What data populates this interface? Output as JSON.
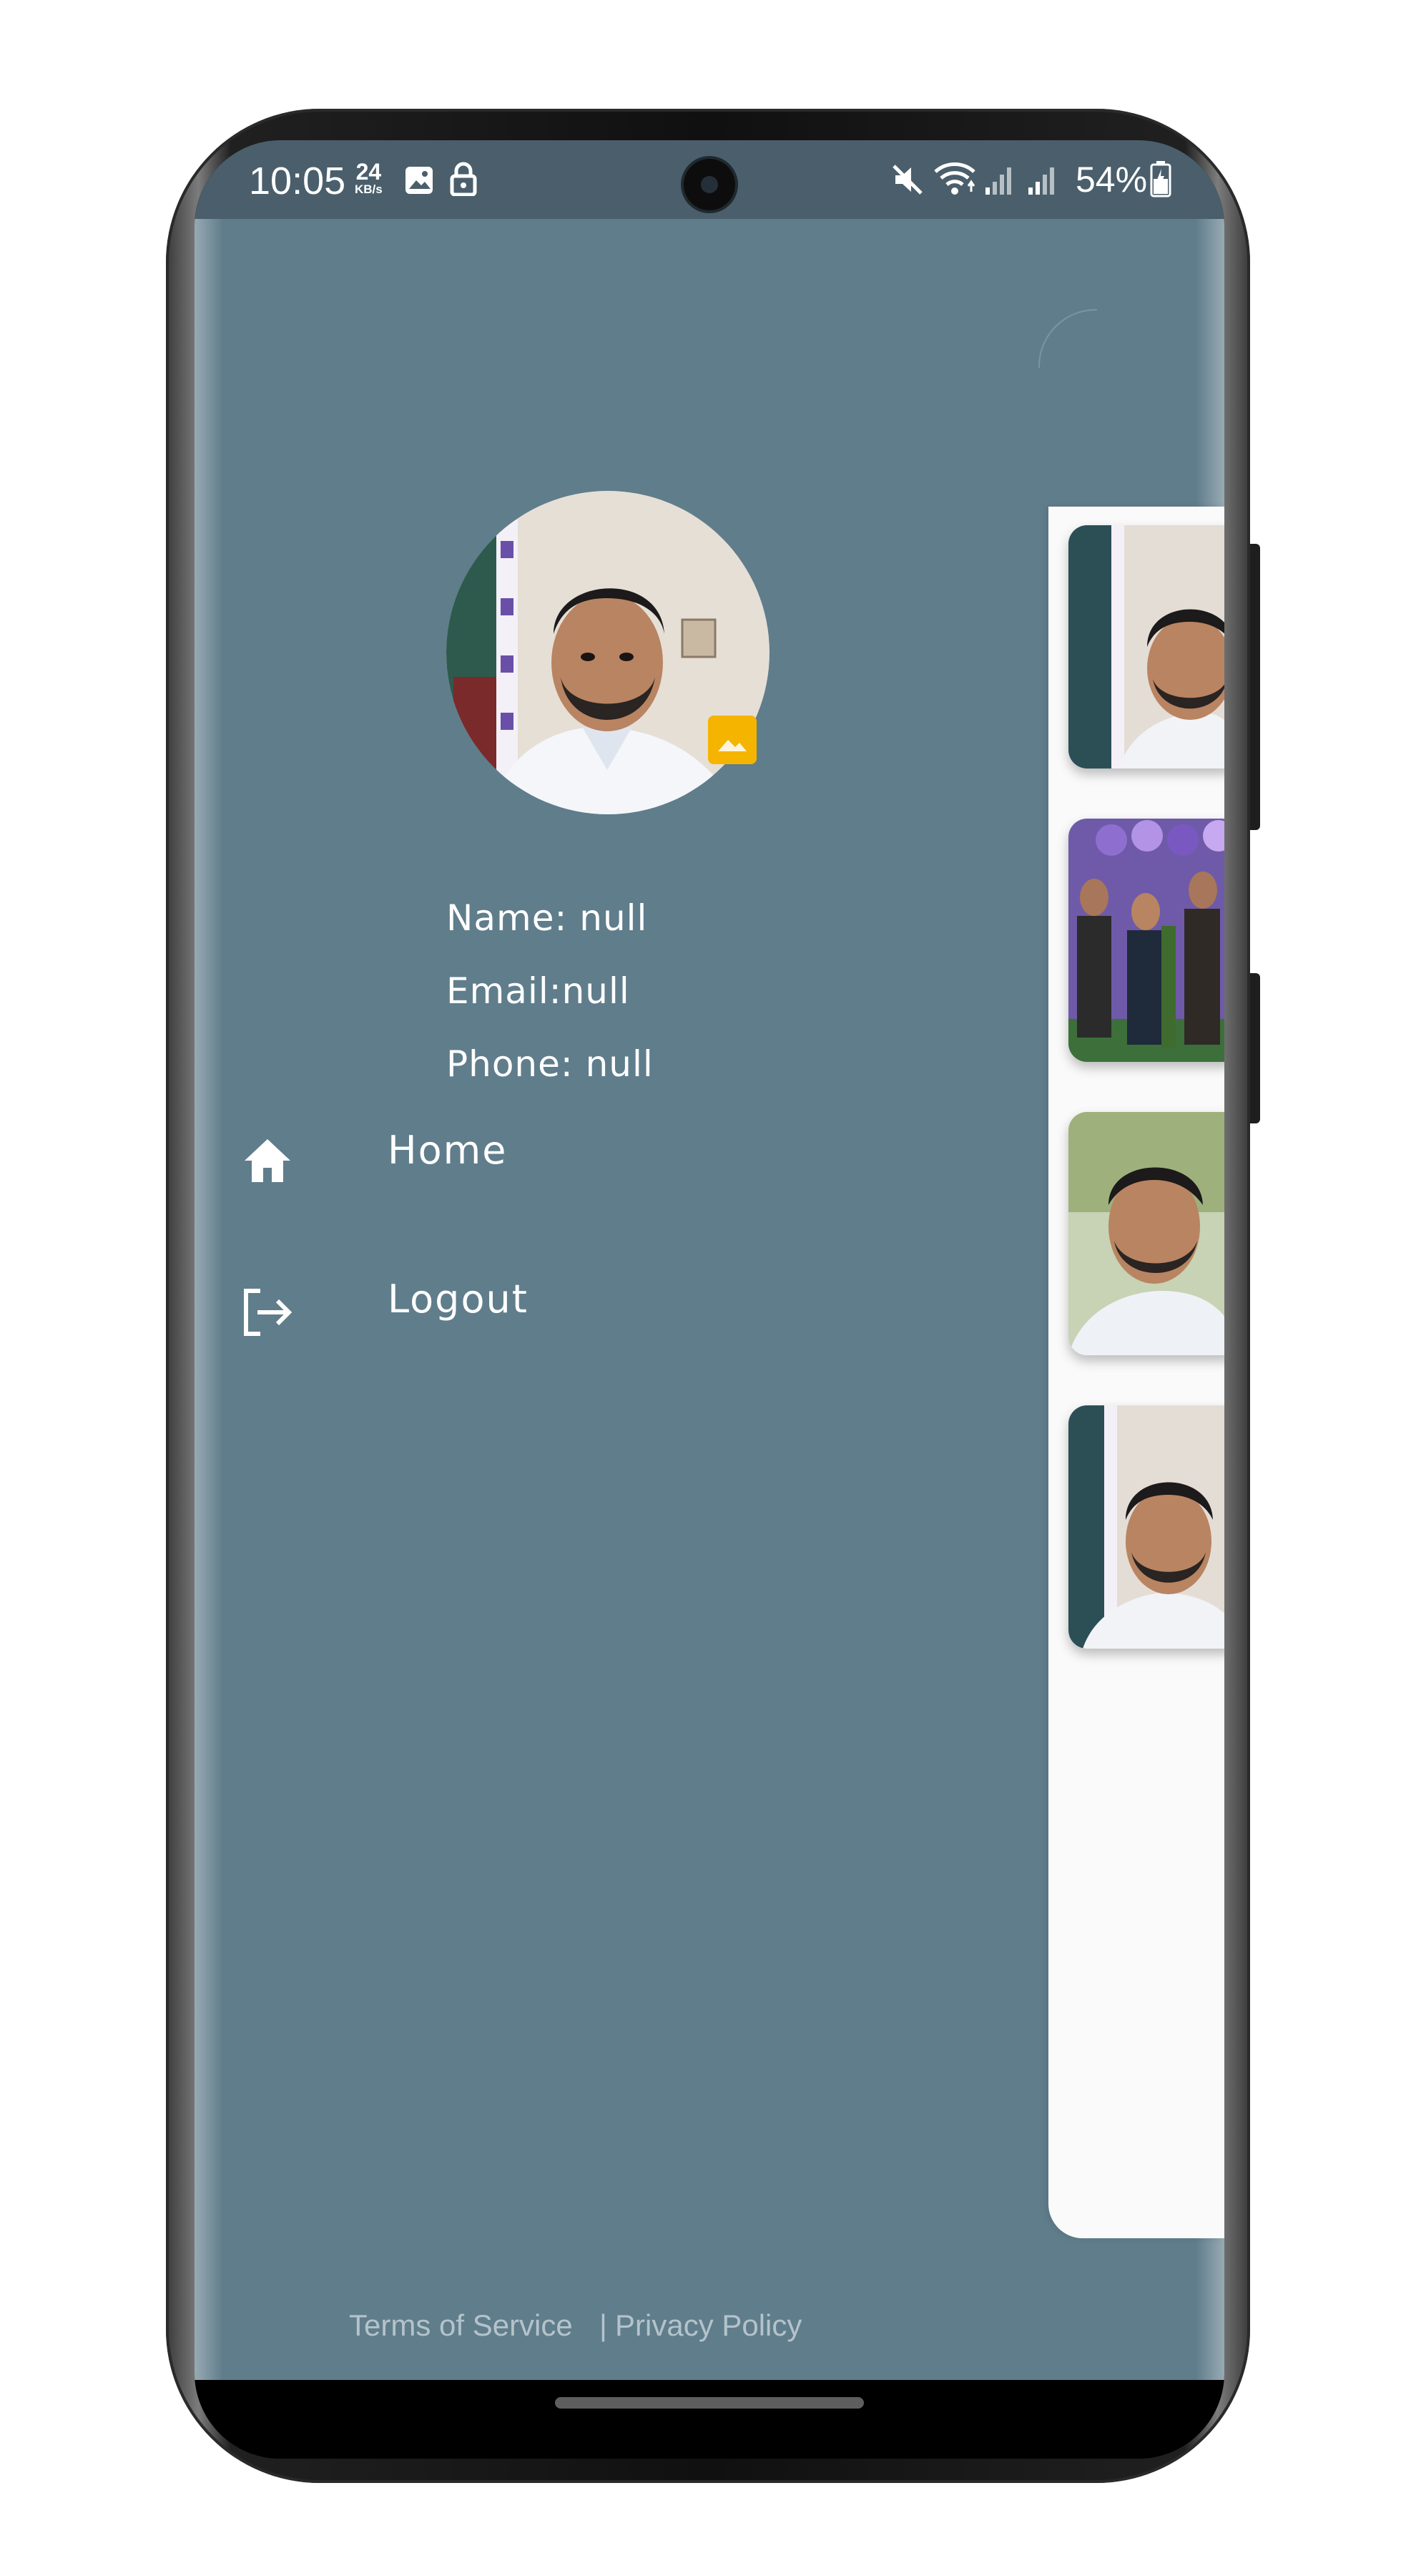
{
  "status_bar": {
    "time": "10:05",
    "net_speed_value": "24",
    "net_speed_unit": "KB/s",
    "battery": "54%",
    "icons": [
      "image-icon",
      "lock-icon",
      "mute-icon",
      "wifi-icon",
      "signal-icon",
      "signal-icon-2",
      "battery-icon"
    ]
  },
  "profile": {
    "name": "Name: null",
    "email": "Email:null",
    "phone": "Phone: null"
  },
  "menu": [
    {
      "label": "Home",
      "icon": "home-icon"
    },
    {
      "label": "Logout",
      "icon": "logout-icon"
    }
  ],
  "footer": {
    "terms": "Terms of Service",
    "separator": "|",
    "privacy": "Privacy Policy"
  },
  "colors": {
    "drawer_bg": "#607d8b",
    "status_bar_bg": "#4a5f6b",
    "footer_text": "#b4c3cb",
    "badge": "#f4b400"
  }
}
